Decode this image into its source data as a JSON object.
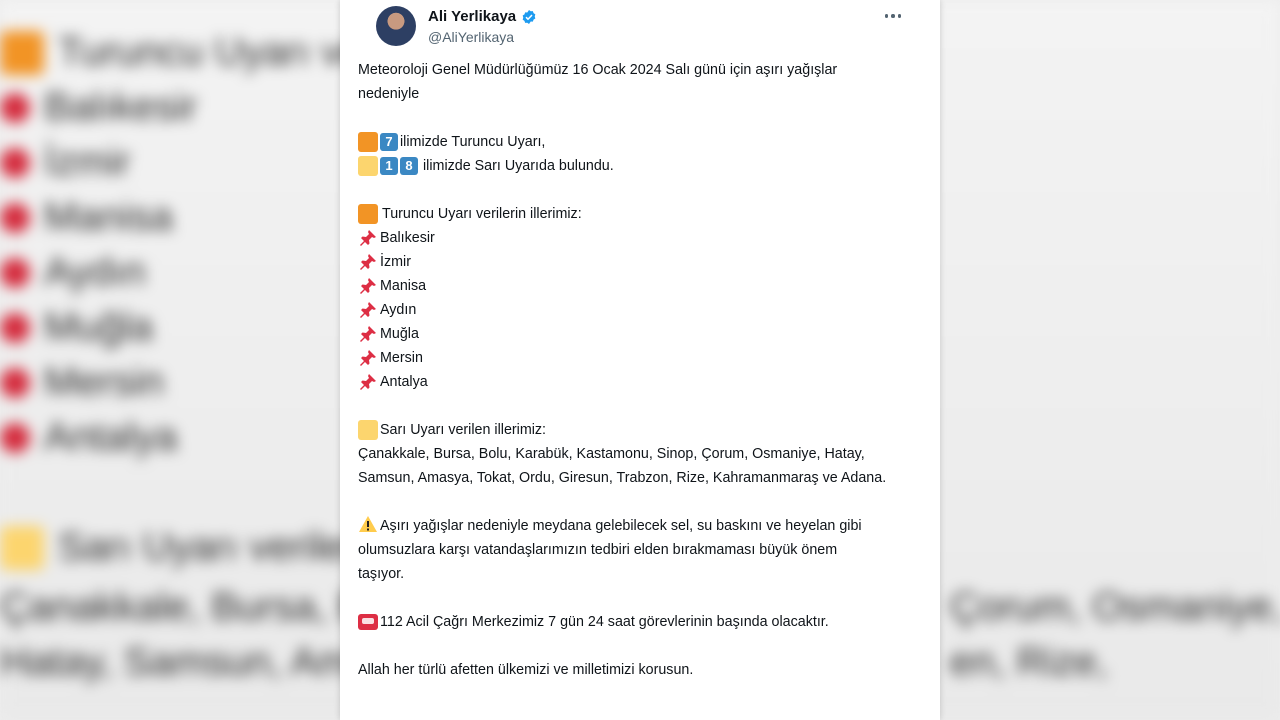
{
  "background": {
    "lines": [
      "Turuncu Uyarı ve",
      "Balıkesir",
      "İzmir",
      "Manisa",
      "Aydın",
      "Muğla",
      "Mersin",
      "Antalya",
      "Sarı Uyarı verilen",
      "Çanakkale, Bursa, Bolu",
      "Hatay, Samsun, Amasya",
      "Çorum, Osmaniye,",
      "en, Rize,"
    ]
  },
  "tweet": {
    "author_name": "Ali Yerlikaya",
    "author_handle": "@AliYerlikaya",
    "intro": "Meteoroloji Genel Müdürlüğümüz 16 Ocak 2024 Salı günü için aşırı yağışlar nedeniyle",
    "orange_count_digit": "7",
    "orange_count_text": "ilimizde Turuncu Uyarı,",
    "yellow_count_digit_1": "1",
    "yellow_count_digit_2": "8",
    "yellow_count_text": "ilimizde Sarı Uyarıda bulundu.",
    "orange_heading": "Turuncu Uyarı verilerin illerimiz:",
    "orange_provinces": [
      "Balıkesir",
      "İzmir",
      "Manisa",
      "Aydın",
      "Muğla",
      "Mersin",
      "Antalya"
    ],
    "yellow_heading": "Sarı Uyarı verilen illerimiz:",
    "yellow_provinces_text": "Çanakkale, Bursa, Bolu, Karabük, Kastamonu, Sinop, Çorum, Osmaniye, Hatay, Samsun, Amasya, Tokat, Ordu, Giresun, Trabzon, Rize, Kahramanmaraş ve Adana.",
    "warning_text": "Aşırı yağışlar nedeniyle meydana gelebilecek sel, su baskını ve heyelan gibi olumsuzlara karşı vatandaşlarımızın tedbiri elden bırakmaması büyük önem taşıyor.",
    "emergency_text": "112 Acil Çağrı Merkezimiz 7 gün 24 saat görevlerinin başında olacaktır.",
    "closing_text": "Allah her türlü afetten ülkemizi ve milletimizi korusun."
  },
  "colors": {
    "orange": "#f29425",
    "yellow": "#fcd56e",
    "verified": "#1d9bf0",
    "pin": "#dd2e44",
    "keycap": "#3b88c3"
  },
  "icons": [
    "verified-icon",
    "more-icon",
    "orange-square-icon",
    "yellow-square-icon",
    "keycap-icon",
    "pushpin-icon",
    "warning-icon",
    "telephone-icon"
  ]
}
